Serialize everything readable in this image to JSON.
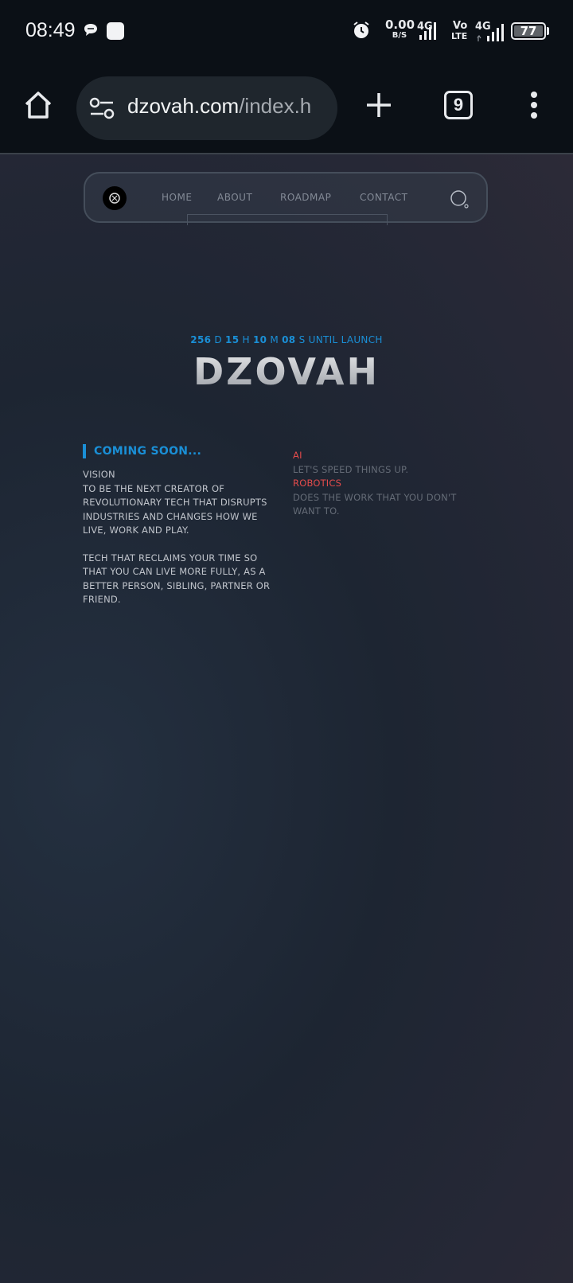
{
  "status_bar": {
    "time": "08:49",
    "net_speed_value": "0.00",
    "net_speed_unit": "B/S",
    "signal1_label": "4G",
    "volte_line1": "Vo",
    "volte_line2": "LTE",
    "signal2_label": "4G",
    "battery": "77",
    "icons": [
      "chat-bubble-icon",
      "app-square-icon",
      "alarm-icon",
      "signal-icon",
      "battery-icon"
    ]
  },
  "browser": {
    "url_host": "dzovah.com",
    "url_path": "/index.h",
    "tab_count": "9",
    "icons": [
      "home-icon",
      "site-settings-icon",
      "new-tab-icon",
      "tab-switcher-icon",
      "menu-icon"
    ]
  },
  "site": {
    "nav": [
      "HOME",
      "ABOUT",
      "ROADMAP",
      "CONTACT"
    ],
    "countdown": {
      "days": "256",
      "d": "D",
      "hours": "15",
      "h": "H",
      "minutes": "10",
      "m": "M",
      "seconds": "08",
      "s": "S",
      "suffix": "UNTIL LAUNCH"
    },
    "brand": "DZOVAH",
    "coming_soon": "COMING SOON...",
    "vision_title": "VISION",
    "vision_text": "TO BE THE NEXT CREATOR OF REVOLUTIONARY TECH THAT DISRUPTS INDUSTRIES AND CHANGES HOW WE LIVE, WORK AND PLAY.",
    "vision_text2": "TECH THAT RECLAIMS YOUR TIME SO THAT YOU CAN LIVE MORE FULLY, AS A BETTER PERSON, SIBLING, PARTNER OR FRIEND.",
    "ai_title": "AI",
    "ai_text": "LET'S SPEED THINGS UP.",
    "robotics_title": "ROBOTICS",
    "robotics_text": "DOES THE WORK THAT YOU DON'T WANT TO."
  },
  "colors": {
    "accent_blue": "#1a8fd6",
    "accent_red": "#e34b4b"
  }
}
